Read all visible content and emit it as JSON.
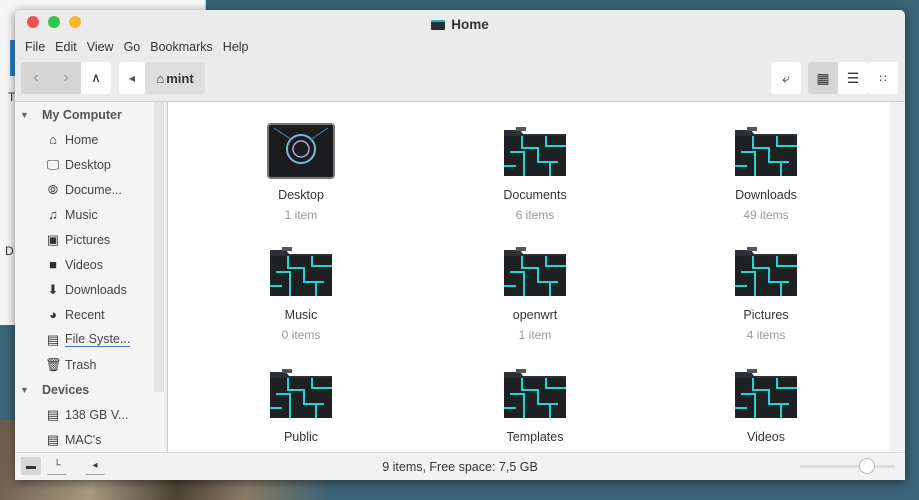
{
  "window": {
    "title": "Home",
    "colors": {
      "close": "#ec4f4f",
      "maximize": "#33c748",
      "minimize": "#f5b82e",
      "accent": "#3a78c0"
    }
  },
  "menu": [
    "File",
    "Edit",
    "View",
    "Go",
    "Bookmarks",
    "Help"
  ],
  "breadcrumb": {
    "current": "mint"
  },
  "sidebar": {
    "sections": [
      {
        "title": "My Computer",
        "items": [
          {
            "label": "Home",
            "icon": "home-icon"
          },
          {
            "label": "Desktop",
            "icon": "monitor-icon"
          },
          {
            "label": "Docume...",
            "icon": "paperclip-icon"
          },
          {
            "label": "Music",
            "icon": "music-note-icon"
          },
          {
            "label": "Pictures",
            "icon": "picture-icon"
          },
          {
            "label": "Videos",
            "icon": "video-camera-icon"
          },
          {
            "label": "Downloads",
            "icon": "download-icon"
          },
          {
            "label": "Recent",
            "icon": "clock-icon"
          },
          {
            "label": "File Syste...",
            "icon": "drive-icon"
          },
          {
            "label": "Trash",
            "icon": "trash-icon"
          }
        ]
      },
      {
        "title": "Devices",
        "items": [
          {
            "label": "138 GB V...",
            "icon": "drive-icon"
          },
          {
            "label": "MAC's",
            "icon": "drive-icon"
          }
        ]
      }
    ]
  },
  "files": [
    {
      "name": "Desktop",
      "count": "1 item"
    },
    {
      "name": "Documents",
      "count": "6 items"
    },
    {
      "name": "Downloads",
      "count": "49 items"
    },
    {
      "name": "Music",
      "count": "0 items"
    },
    {
      "name": "openwrt",
      "count": "1 item"
    },
    {
      "name": "Pictures",
      "count": "4 items"
    },
    {
      "name": "Public",
      "count": ""
    },
    {
      "name": "Templates",
      "count": ""
    },
    {
      "name": "Videos",
      "count": ""
    }
  ],
  "status": {
    "text": "9 items, Free space: 7,5 GB",
    "zoom_fraction": 0.7
  },
  "background": {
    "letter_t": "T",
    "letter_d": "D"
  }
}
